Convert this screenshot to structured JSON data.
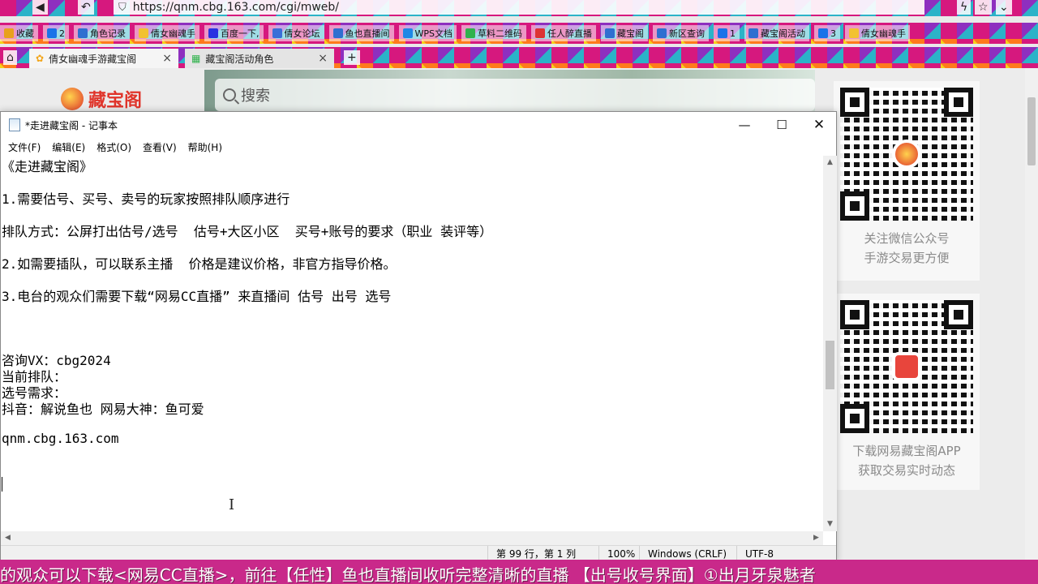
{
  "browser": {
    "url": "https://qnm.cbg.163.com/cgi/mweb/",
    "bookmarks": [
      {
        "label": "收藏",
        "color": "#e8a11c"
      },
      {
        "label": "2",
        "color": "#1a73e8"
      },
      {
        "label": "角色记录",
        "color": "#2f6fd0"
      },
      {
        "label": "倩女幽魂手",
        "color": "#f2c230"
      },
      {
        "label": "百度一下,",
        "color": "#2932e1"
      },
      {
        "label": "倩女论坛",
        "color": "#3a6fd8"
      },
      {
        "label": "鱼也直播间",
        "color": "#2f6fd0"
      },
      {
        "label": "WPS文档",
        "color": "#1e88e5"
      },
      {
        "label": "草料二维码",
        "color": "#2fb24c"
      },
      {
        "label": "任人醉直播",
        "color": "#d33"
      },
      {
        "label": "藏宝阁",
        "color": "#2f6fd0"
      },
      {
        "label": "新区查询",
        "color": "#2f6fd0"
      },
      {
        "label": "1",
        "color": "#1a73e8"
      },
      {
        "label": "藏宝阁活动",
        "color": "#2f6fd0"
      },
      {
        "label": "3",
        "color": "#1a73e8"
      },
      {
        "label": "倩女幽魂手",
        "color": "#f2c230"
      }
    ],
    "tabs": [
      {
        "label": "倩女幽魂手游藏宝阁"
      },
      {
        "label": "藏宝阁活动角色"
      }
    ]
  },
  "webpage": {
    "logo_text": "藏宝阁",
    "search_placeholder": "搜索",
    "qr_cards": [
      {
        "caption_line1": "关注微信公众号",
        "caption_line2": "手游交易更方便"
      },
      {
        "caption_line1": "下载网易藏宝阁APP",
        "caption_line2": "获取交易实时动态"
      }
    ]
  },
  "notepad": {
    "title": "*走进藏宝阁 - 记事本",
    "menus": [
      "文件(F)",
      "编辑(E)",
      "格式(O)",
      "查看(V)",
      "帮助(H)"
    ],
    "lines": [
      "《走进藏宝阁》",
      "1.需要估号、买号、卖号的玩家按照排队顺序进行",
      "排队方式：公屏打出估号/选号  估号+大区小区  买号+账号的要求（职业 装评等）",
      "2.如需要插队，可以联系主播  价格是建议价格，非官方指导价格。",
      "3.电台的观众们需要下载“网易CC直播” 来直播间 估号 出号 选号",
      "咨询VX：cbg2024",
      "当前排队：",
      "选号需求：",
      "抖音：解说鱼也 网易大神：鱼可爱",
      "qnm.cbg.163.com"
    ],
    "status": {
      "position": "第 99 行，第 1 列",
      "zoom": "100%",
      "line_ending": "Windows (CRLF)",
      "encoding": "UTF-8"
    }
  },
  "ticker": {
    "text": "的观众可以下载<网易CC直播>，前往【任性】鱼也直播间收听完整清晰的直播    【出号收号界面】①出月牙泉魅者"
  }
}
